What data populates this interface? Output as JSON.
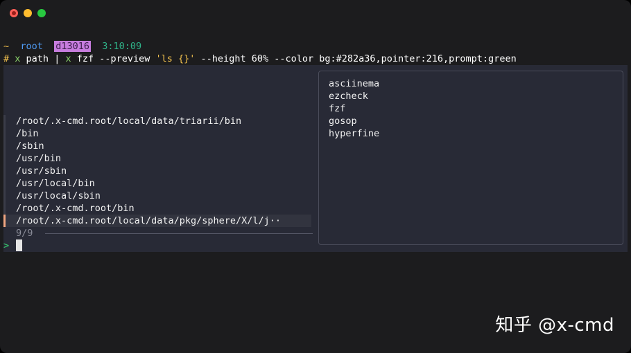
{
  "prompt": {
    "tilde": "~",
    "user": "root",
    "host": "d13016",
    "time": "3:10:09"
  },
  "command": {
    "hash": "#",
    "x1": "x",
    "part1": " path | ",
    "x2": "x",
    "part2": " fzf --preview ",
    "preview_arg": "'ls {}'",
    "part3": " --height 60% --color bg:#282a36,pointer:216,prompt:green"
  },
  "fzf": {
    "items": [
      "/root/.x-cmd.root/local/data/triarii/bin",
      "/bin",
      "/sbin",
      "/usr/bin",
      "/usr/sbin",
      "/usr/local/bin",
      "/usr/local/sbin",
      "/root/.x-cmd.root/bin",
      "/root/.x-cmd.root/local/data/pkg/sphere/X/l/j··"
    ],
    "selected_index": 8,
    "count": "9/9",
    "prompt_symbol": ">",
    "query": ""
  },
  "preview": {
    "items": [
      "asciinema",
      "ezcheck",
      "fzf",
      "gosop",
      "hyperfine"
    ]
  },
  "watermark": "知乎 @x-cmd",
  "colors": {
    "fzf_bg": "#282a36",
    "pointer": "#f0a580",
    "prompt": "#37d36e"
  }
}
